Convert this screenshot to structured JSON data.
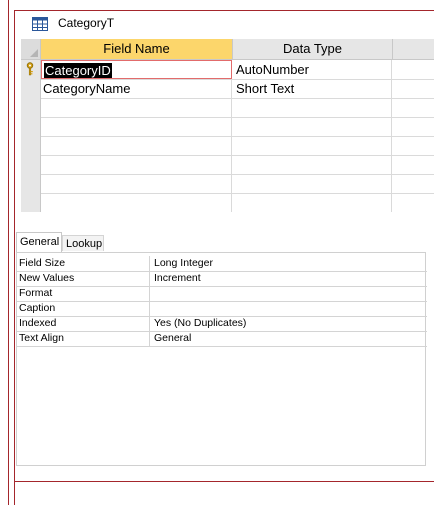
{
  "window": {
    "title": "CategoryT",
    "icon": "table-icon"
  },
  "grid": {
    "columns": [
      "Field Name",
      "Data Type",
      ""
    ],
    "rows": [
      {
        "field_name": "CategoryID",
        "data_type": "AutoNumber",
        "description": "",
        "primary_key": true,
        "selected": true
      },
      {
        "field_name": "CategoryName",
        "data_type": "Short Text",
        "description": "",
        "primary_key": false,
        "selected": false
      },
      {
        "field_name": "",
        "data_type": "",
        "description": ""
      },
      {
        "field_name": "",
        "data_type": "",
        "description": ""
      },
      {
        "field_name": "",
        "data_type": "",
        "description": ""
      },
      {
        "field_name": "",
        "data_type": "",
        "description": ""
      },
      {
        "field_name": "",
        "data_type": "",
        "description": ""
      },
      {
        "field_name": "",
        "data_type": "",
        "description": ""
      }
    ]
  },
  "properties": {
    "tabs": [
      {
        "label": "General",
        "active": true
      },
      {
        "label": "Lookup",
        "active": false
      }
    ],
    "rows": [
      {
        "name": "Field Size",
        "value": "Long Integer"
      },
      {
        "name": "New Values",
        "value": "Increment"
      },
      {
        "name": "Format",
        "value": ""
      },
      {
        "name": "Caption",
        "value": ""
      },
      {
        "name": "Indexed",
        "value": "Yes (No Duplicates)"
      },
      {
        "name": "Text Align",
        "value": "General"
      }
    ]
  },
  "colors": {
    "frame": "#a4262c",
    "header_highlight": "#fcd66b",
    "active_cell_border": "#e26b6b"
  }
}
